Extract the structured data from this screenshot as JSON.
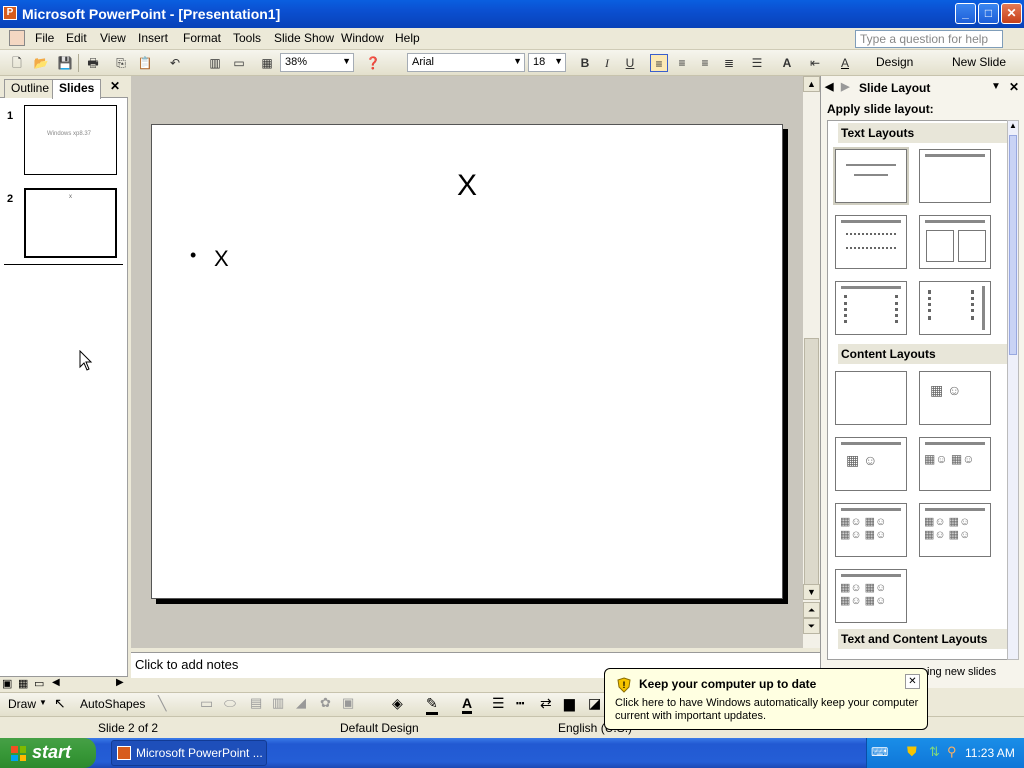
{
  "window": {
    "title": "Microsoft PowerPoint - [Presentation1]",
    "min": "_",
    "max": "□",
    "close": "✕"
  },
  "menu": [
    "File",
    "Edit",
    "View",
    "Insert",
    "Format",
    "Tools",
    "Slide Show",
    "Window",
    "Help"
  ],
  "help_placeholder": "Type a question for help",
  "toolbar": {
    "zoom": "38%",
    "font": "Arial",
    "size": "18",
    "bold": "B",
    "italic": "I",
    "underline": "U",
    "design": "Design",
    "new_slide": "New Slide"
  },
  "leftpane": {
    "tabs": [
      "Outline",
      "Slides"
    ],
    "close": "✕",
    "slides": [
      {
        "num": "1",
        "text": "Windows xp8.37"
      },
      {
        "num": "2",
        "text": "x"
      }
    ]
  },
  "slide": {
    "title": "X",
    "bullet": "•",
    "body": "X"
  },
  "notes": "Click to add notes",
  "taskpane": {
    "title": "Slide Layout",
    "apply": "Apply slide layout:",
    "sections": [
      "Text Layouts",
      "Content Layouts",
      "Text and Content Layouts"
    ],
    "footer_partial": "ing new slides"
  },
  "drawbar": {
    "draw": "Draw",
    "autoshapes": "AutoShapes"
  },
  "status": {
    "slide": "Slide 2 of 2",
    "design": "Default Design",
    "lang": "English (U.S.)"
  },
  "balloon": {
    "title": "Keep your computer up to date",
    "body": "Click here to have Windows automatically keep your computer current with important updates.",
    "close": "✕"
  },
  "taskbar": {
    "start": "start",
    "item": "Microsoft PowerPoint ...",
    "time": "11:23 AM"
  },
  "colors": {
    "titlebar": "#0a5fe0",
    "start": "#389838",
    "taskbar": "#245ed6",
    "balloon": "#ffffe1"
  }
}
